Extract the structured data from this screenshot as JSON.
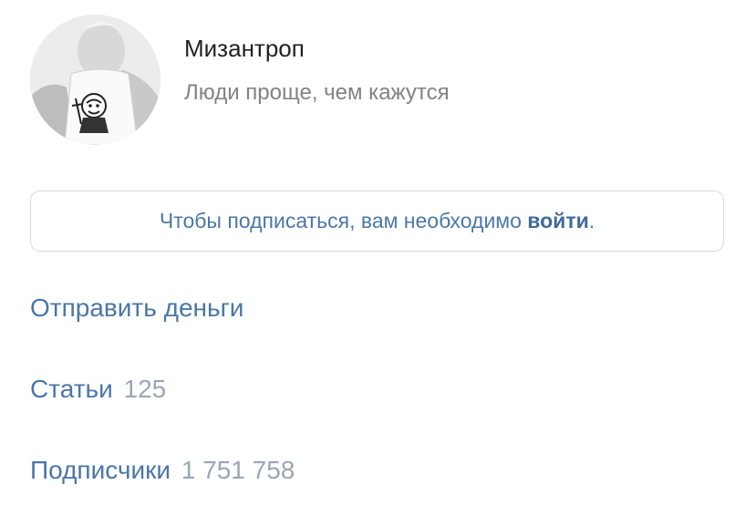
{
  "channel": {
    "name": "Мизантроп",
    "description": "Люди проще, чем кажутся",
    "avatar_icon": "avatar-photo"
  },
  "subscribe": {
    "text_before": "Чтобы подписаться, вам необходимо ",
    "login_label": "войти",
    "text_after": "."
  },
  "links": {
    "send_money": "Отправить деньги",
    "articles_label": "Статьи",
    "articles_count": "125",
    "subscribers_label": "Подписчики",
    "subscribers_count": "1 751 758"
  },
  "colors": {
    "link": "#4a76a8",
    "count": "#9aa7b5",
    "title": "#222222",
    "subtitle": "#828282",
    "border": "#d3d9de"
  }
}
